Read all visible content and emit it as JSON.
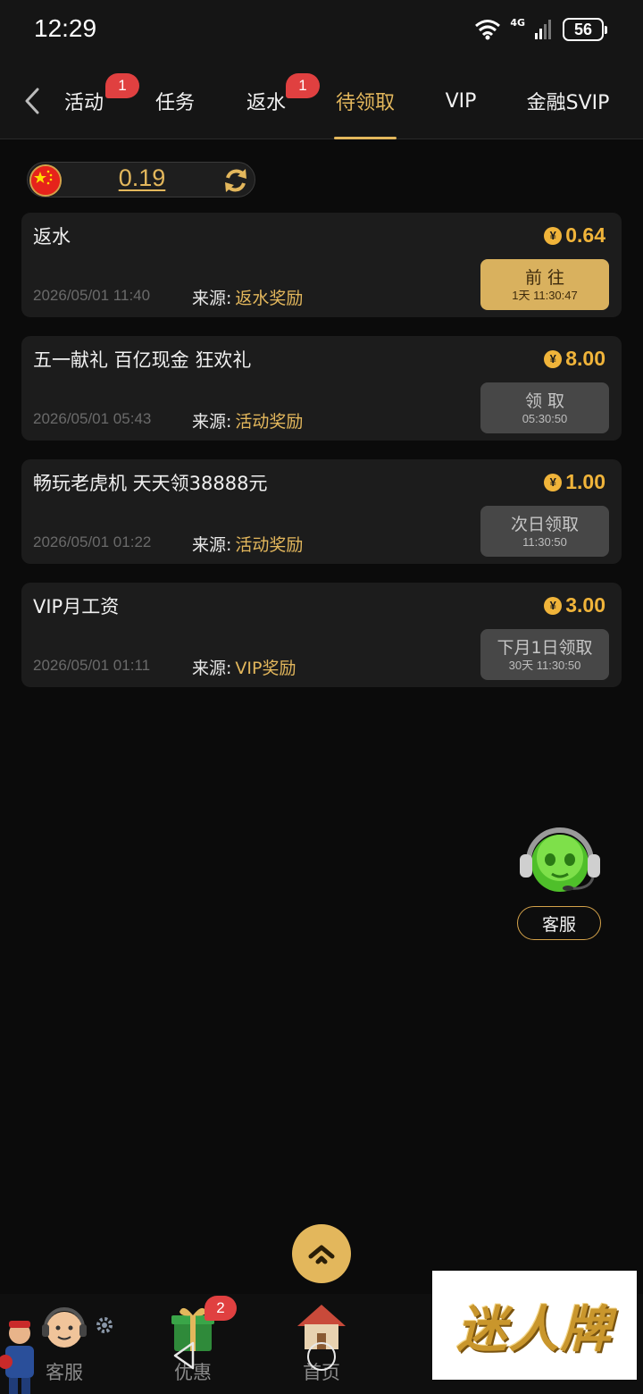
{
  "status_bar": {
    "time": "12:29",
    "network": "4G",
    "battery": "56"
  },
  "tabs": [
    {
      "label": "活动",
      "badge": "1"
    },
    {
      "label": "任务"
    },
    {
      "label": "返水",
      "badge": "1"
    },
    {
      "label": "待领取",
      "active": true
    },
    {
      "label": "VIP"
    },
    {
      "label": "金融SVIP"
    }
  ],
  "balance": {
    "value": "0.19",
    "flag_icon": "china-flag-icon"
  },
  "source_prefix": "来源:",
  "rewards": [
    {
      "title": "返水",
      "currency": "¥",
      "amount": "0.64",
      "date": "2026/05/01 11:40",
      "source": "返水奖励",
      "button_label": "前 往",
      "button_timer": "1天 11:30:47",
      "button_style": "gold"
    },
    {
      "title": "五一献礼 百亿现金 狂欢礼",
      "currency": "¥",
      "amount": "8.00",
      "date": "2026/05/01 05:43",
      "source": "活动奖励",
      "button_label": "领 取",
      "button_timer": "05:30:50",
      "button_style": "gray"
    },
    {
      "title": "畅玩老虎机 天天领38888元",
      "currency": "¥",
      "amount": "1.00",
      "date": "2026/05/01 01:22",
      "source": "活动奖励",
      "button_label": "次日领取",
      "button_timer": "11:30:50",
      "button_style": "gray"
    },
    {
      "title": "VIP月工资",
      "currency": "¥",
      "amount": "3.00",
      "date": "2026/05/01 01:11",
      "source": "VIP奖励",
      "button_label": "下月1日领取",
      "button_timer": "30天 11:30:50",
      "button_style": "gray"
    }
  ],
  "floating_service": {
    "label": "客服"
  },
  "bottom_nav": [
    {
      "label": "客服",
      "icon": "customer-service-icon"
    },
    {
      "label": "优惠",
      "icon": "gift-icon",
      "badge": "2"
    },
    {
      "label": "首页",
      "icon": "home-icon"
    }
  ],
  "watermark": {
    "text": "迷人牌"
  },
  "colors": {
    "accent": "#e3b75c",
    "badge": "#e04040",
    "amount": "#f0b43a",
    "background": "#0b0b0b",
    "card": "#1c1c1c"
  }
}
